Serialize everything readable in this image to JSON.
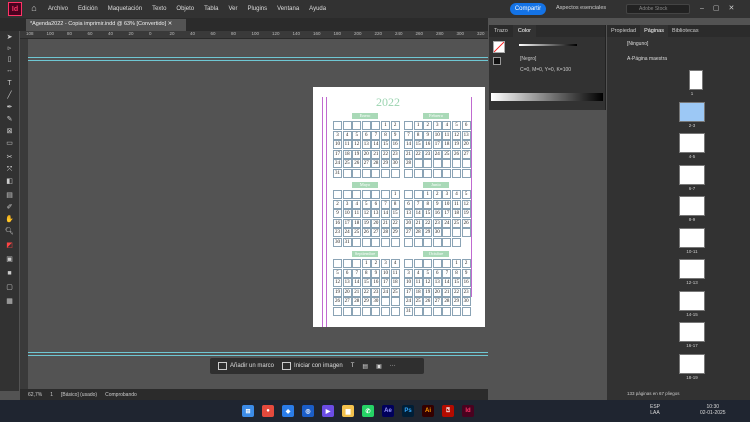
{
  "app": {
    "logo": "Id"
  },
  "menu": [
    "Archivo",
    "Edición",
    "Maquetación",
    "Texto",
    "Objeto",
    "Tabla",
    "Ver",
    "Plugins",
    "Ventana",
    "Ayuda"
  ],
  "header": {
    "share_label": "Compartir",
    "workspace": "Aspectos esenciales",
    "stock_placeholder": "Adobe Stock"
  },
  "doc_tab": {
    "title": "*Agenda2022 - Copia imprimir.indd @ 63% [Convertido]"
  },
  "ruler": [
    "108",
    "100",
    "80",
    "60",
    "40",
    "20",
    "0",
    "20",
    "40",
    "60",
    "80",
    "100",
    "120",
    "140",
    "160",
    "180",
    "200",
    "220",
    "240",
    "260",
    "280",
    "300",
    "320"
  ],
  "page": {
    "year": "2022",
    "months": [
      {
        "name": "Enero",
        "days": [
          "",
          "",
          "",
          "",
          "",
          "1",
          "2",
          "3",
          "4",
          "5",
          "6",
          "7",
          "8",
          "9",
          "10",
          "11",
          "12",
          "13",
          "14",
          "15",
          "16",
          "17",
          "18",
          "19",
          "20",
          "21",
          "22",
          "23",
          "24",
          "25",
          "26",
          "27",
          "28",
          "29",
          "30",
          "31",
          "",
          "",
          "",
          "",
          "",
          ""
        ]
      },
      {
        "name": "Febrero",
        "days": [
          "",
          "1",
          "2",
          "3",
          "4",
          "5",
          "6",
          "7",
          "8",
          "9",
          "10",
          "11",
          "12",
          "13",
          "14",
          "15",
          "16",
          "17",
          "18",
          "19",
          "20",
          "21",
          "22",
          "23",
          "24",
          "25",
          "26",
          "27",
          "28",
          "",
          "",
          "",
          "",
          "",
          "",
          "",
          "",
          "",
          "",
          "",
          "",
          ""
        ]
      },
      {
        "name": "Mayo",
        "days": [
          "",
          "",
          "",
          "",
          "",
          "",
          "1",
          "2",
          "3",
          "4",
          "5",
          "6",
          "7",
          "8",
          "9",
          "10",
          "11",
          "12",
          "13",
          "14",
          "15",
          "16",
          "17",
          "18",
          "19",
          "20",
          "21",
          "22",
          "23",
          "24",
          "25",
          "26",
          "27",
          "28",
          "29",
          "30",
          "31",
          "",
          "",
          "",
          "",
          ""
        ]
      },
      {
        "name": "Junio",
        "days": [
          "",
          "",
          "1",
          "2",
          "3",
          "4",
          "5",
          "6",
          "7",
          "8",
          "9",
          "10",
          "11",
          "12",
          "13",
          "14",
          "15",
          "16",
          "17",
          "18",
          "19",
          "20",
          "21",
          "22",
          "23",
          "24",
          "25",
          "26",
          "27",
          "28",
          "29",
          "30",
          "",
          "",
          "",
          "",
          "",
          "",
          "",
          "",
          ""
        ]
      },
      {
        "name": "Septiembre",
        "days": [
          "",
          "",
          "",
          "1",
          "2",
          "3",
          "4",
          "5",
          "6",
          "7",
          "8",
          "9",
          "10",
          "11",
          "12",
          "13",
          "14",
          "15",
          "16",
          "17",
          "18",
          "19",
          "20",
          "21",
          "22",
          "23",
          "24",
          "25",
          "26",
          "27",
          "28",
          "29",
          "30",
          "",
          "",
          "",
          "",
          "",
          "",
          "",
          "",
          ""
        ]
      },
      {
        "name": "Octubre",
        "days": [
          "",
          "",
          "",
          "",
          "",
          "1",
          "2",
          "3",
          "4",
          "5",
          "6",
          "7",
          "8",
          "9",
          "10",
          "11",
          "12",
          "13",
          "14",
          "15",
          "16",
          "17",
          "18",
          "19",
          "20",
          "21",
          "22",
          "23",
          "24",
          "25",
          "26",
          "27",
          "28",
          "29",
          "30",
          "31",
          "",
          "",
          "",
          "",
          "",
          ""
        ]
      }
    ]
  },
  "control_bar": {
    "add_frame": "Añadir un marco",
    "start_image": "Iniciar con imagen",
    "more": "···"
  },
  "status_bar": {
    "zoom": "62,7%",
    "page": "1",
    "style": "[Básico] (usado)",
    "preflight": "Comprobando"
  },
  "color_panel": {
    "tabs": [
      "Trazo",
      "Color"
    ],
    "swatch": "[Negro]",
    "value": "C=0, M=0, Y=0, K=100"
  },
  "pages_panel": {
    "tabs": [
      "Propiedad",
      "Páginas",
      "Bibliotecas"
    ],
    "none": "[Ninguno]",
    "master": "A-Página maestra",
    "labels": [
      "1",
      "2-3",
      "4-5",
      "6-7",
      "8-9",
      "10-11",
      "12-13",
      "14-15",
      "16-17",
      "18-19"
    ],
    "footer": "133 páginas en 67 pliegos"
  },
  "taskbar": {
    "lang": "ESP",
    "lang2": "LAA",
    "time": "10:30",
    "date": "02-01-2025"
  },
  "colors": {
    "accent": "#1473e6",
    "brand": "#ff3366",
    "guide": "#6fc7d3",
    "month_label": "#a9d9b7"
  }
}
